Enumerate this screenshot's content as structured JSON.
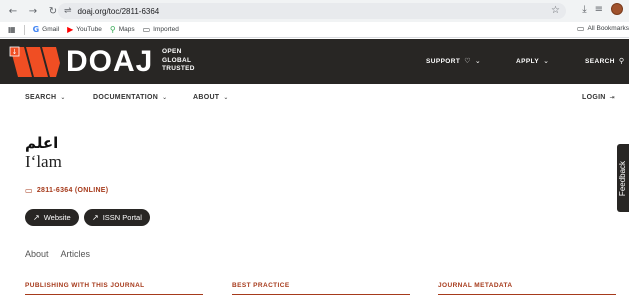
{
  "browser": {
    "url": "doaj.org/toc/2811-6364",
    "bookmarks": [
      {
        "label": "Gmail",
        "icon": "gmail-icon"
      },
      {
        "label": "YouTube",
        "icon": "youtube-icon"
      },
      {
        "label": "Maps",
        "icon": "maps-icon"
      },
      {
        "label": "Imported",
        "icon": "folder-icon"
      }
    ],
    "all_bookmarks": "All Bookmarks"
  },
  "header": {
    "logo": "DOAJ",
    "tagline": [
      "OPEN",
      "GLOBAL",
      "TRUSTED"
    ],
    "support": "SUPPORT",
    "apply": "APPLY",
    "search": "SEARCH"
  },
  "nav": {
    "search": "SEARCH",
    "documentation": "DOCUMENTATION",
    "about": "ABOUT",
    "login": "LOGIN"
  },
  "journal": {
    "title_arabic": "اعلم",
    "title": "I‘lam",
    "issn": "2811-6364 (ONLINE)",
    "website": "Website",
    "issn_portal": "ISSN Portal"
  },
  "tabs": [
    "About",
    "Articles"
  ],
  "sections": {
    "publishing": "PUBLISHING WITH THIS JOURNAL",
    "best_practice": "BEST PRACTICE",
    "metadata": "JOURNAL METADATA"
  },
  "feedback": "Feedback",
  "colors": {
    "header_bg": "#282624",
    "accent": "#a63a1b",
    "logo_orange": "#f04e23"
  }
}
